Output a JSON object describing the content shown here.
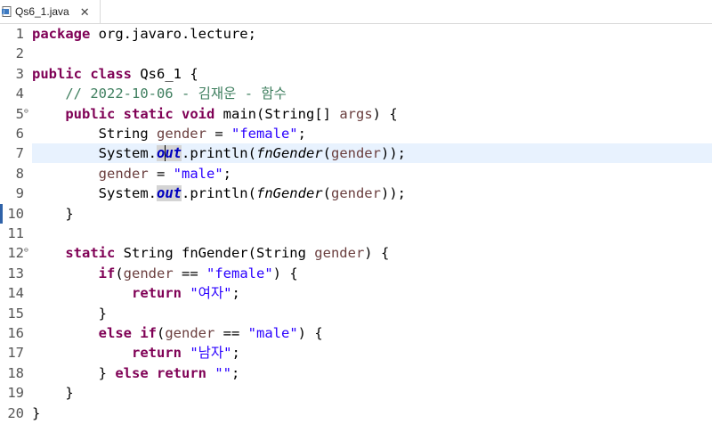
{
  "tab": {
    "filename": "Qs6_1.java",
    "close_glyph": "✕"
  },
  "editor": {
    "lines": [
      {
        "num": "1",
        "tokens": [
          {
            "t": "package",
            "c": "kw"
          },
          {
            "t": " org.javaro.lecture;",
            "c": ""
          }
        ]
      },
      {
        "num": "2",
        "tokens": []
      },
      {
        "num": "3",
        "tokens": [
          {
            "t": "public",
            "c": "kw"
          },
          {
            "t": " ",
            "c": ""
          },
          {
            "t": "class",
            "c": "kw"
          },
          {
            "t": " Qs6_1 {",
            "c": ""
          }
        ]
      },
      {
        "num": "4",
        "tokens": [
          {
            "t": "    ",
            "c": ""
          },
          {
            "t": "// 2022-10-06 - 김재운 - 함수",
            "c": "cmt"
          }
        ]
      },
      {
        "num": "5",
        "fold": true,
        "tokens": [
          {
            "t": "    ",
            "c": ""
          },
          {
            "t": "public",
            "c": "kw"
          },
          {
            "t": " ",
            "c": ""
          },
          {
            "t": "static",
            "c": "kw"
          },
          {
            "t": " ",
            "c": ""
          },
          {
            "t": "void",
            "c": "kw"
          },
          {
            "t": " main(String[] ",
            "c": ""
          },
          {
            "t": "args",
            "c": "loc"
          },
          {
            "t": ") {",
            "c": ""
          }
        ]
      },
      {
        "num": "6",
        "tokens": [
          {
            "t": "        String ",
            "c": ""
          },
          {
            "t": "gender",
            "c": "loc"
          },
          {
            "t": " = ",
            "c": ""
          },
          {
            "t": "\"female\"",
            "c": "str"
          },
          {
            "t": ";",
            "c": ""
          }
        ]
      },
      {
        "num": "7",
        "current": true,
        "tokens": [
          {
            "t": "        System.",
            "c": ""
          },
          {
            "t": "out",
            "c": "fld fld-hl"
          },
          {
            "t": ".println(",
            "c": ""
          },
          {
            "t": "fnGender",
            "c": "mth"
          },
          {
            "t": "(",
            "c": ""
          },
          {
            "t": "gender",
            "c": "loc"
          },
          {
            "t": "));",
            "c": ""
          }
        ]
      },
      {
        "num": "8",
        "tokens": [
          {
            "t": "        ",
            "c": ""
          },
          {
            "t": "gender",
            "c": "loc"
          },
          {
            "t": " = ",
            "c": ""
          },
          {
            "t": "\"male\"",
            "c": "str"
          },
          {
            "t": ";",
            "c": ""
          }
        ]
      },
      {
        "num": "9",
        "tokens": [
          {
            "t": "        System.",
            "c": ""
          },
          {
            "t": "out",
            "c": "fld fld-hl"
          },
          {
            "t": ".println(",
            "c": ""
          },
          {
            "t": "fnGender",
            "c": "mth"
          },
          {
            "t": "(",
            "c": ""
          },
          {
            "t": "gender",
            "c": "loc"
          },
          {
            "t": "));",
            "c": ""
          }
        ]
      },
      {
        "num": "10",
        "marker": true,
        "tokens": [
          {
            "t": "    }",
            "c": ""
          }
        ]
      },
      {
        "num": "11",
        "tokens": []
      },
      {
        "num": "12",
        "fold": true,
        "tokens": [
          {
            "t": "    ",
            "c": ""
          },
          {
            "t": "static",
            "c": "kw"
          },
          {
            "t": " String fnGender(String ",
            "c": ""
          },
          {
            "t": "gender",
            "c": "loc"
          },
          {
            "t": ") {",
            "c": ""
          }
        ]
      },
      {
        "num": "13",
        "tokens": [
          {
            "t": "        ",
            "c": ""
          },
          {
            "t": "if",
            "c": "kw"
          },
          {
            "t": "(",
            "c": ""
          },
          {
            "t": "gender",
            "c": "loc"
          },
          {
            "t": " == ",
            "c": ""
          },
          {
            "t": "\"female\"",
            "c": "str"
          },
          {
            "t": ") {",
            "c": ""
          }
        ]
      },
      {
        "num": "14",
        "tokens": [
          {
            "t": "            ",
            "c": ""
          },
          {
            "t": "return",
            "c": "kw"
          },
          {
            "t": " ",
            "c": ""
          },
          {
            "t": "\"여자\"",
            "c": "str"
          },
          {
            "t": ";",
            "c": ""
          }
        ]
      },
      {
        "num": "15",
        "tokens": [
          {
            "t": "        }",
            "c": ""
          }
        ]
      },
      {
        "num": "16",
        "tokens": [
          {
            "t": "        ",
            "c": ""
          },
          {
            "t": "else",
            "c": "kw"
          },
          {
            "t": " ",
            "c": ""
          },
          {
            "t": "if",
            "c": "kw"
          },
          {
            "t": "(",
            "c": ""
          },
          {
            "t": "gender",
            "c": "loc"
          },
          {
            "t": " == ",
            "c": ""
          },
          {
            "t": "\"male\"",
            "c": "str"
          },
          {
            "t": ") {",
            "c": ""
          }
        ]
      },
      {
        "num": "17",
        "tokens": [
          {
            "t": "            ",
            "c": ""
          },
          {
            "t": "return",
            "c": "kw"
          },
          {
            "t": " ",
            "c": ""
          },
          {
            "t": "\"남자\"",
            "c": "str"
          },
          {
            "t": ";",
            "c": ""
          }
        ]
      },
      {
        "num": "18",
        "tokens": [
          {
            "t": "        } ",
            "c": ""
          },
          {
            "t": "else",
            "c": "kw"
          },
          {
            "t": " ",
            "c": ""
          },
          {
            "t": "return",
            "c": "kw"
          },
          {
            "t": " ",
            "c": ""
          },
          {
            "t": "\"\"",
            "c": "str"
          },
          {
            "t": ";",
            "c": ""
          }
        ]
      },
      {
        "num": "19",
        "tokens": [
          {
            "t": "    }",
            "c": ""
          }
        ]
      },
      {
        "num": "20",
        "tokens": [
          {
            "t": "}",
            "c": ""
          }
        ]
      }
    ]
  },
  "colors": {
    "keyword": "#7f0055",
    "string": "#2a00ff",
    "comment": "#3f7f5f",
    "local_variable": "#6a3e3e",
    "static_field": "#0000c0",
    "current_line": "#e8f2fe"
  },
  "icons": {
    "tab_file": "java-file-icon",
    "fold": "fold-collapse-icon"
  }
}
